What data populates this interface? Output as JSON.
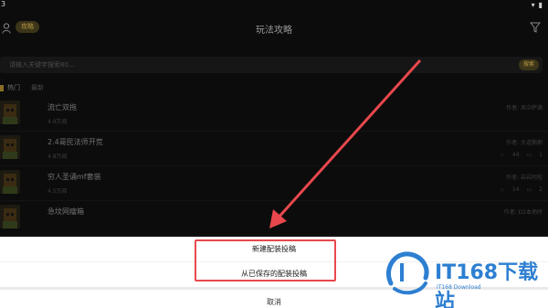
{
  "status_bar": {
    "time": "3"
  },
  "header": {
    "badge": "攻略",
    "title": "玩法攻略"
  },
  "search": {
    "placeholder": "请输入关键字搜索80...",
    "button": "搜索"
  },
  "tabs": [
    {
      "label": "热门"
    },
    {
      "label": "最新"
    }
  ],
  "list": [
    {
      "name": "流亡双拖",
      "count": "4.9万阅",
      "author": "作者: 风中萨满",
      "stats": ""
    },
    {
      "name": "2.4哥民法师开荒",
      "count": "4.8万阅",
      "author": "作者: 大道鹅鹅",
      "stats_likes": "44",
      "stats_comments": "1"
    },
    {
      "name": "穷人圣诵mf套装",
      "count": "4.5万阅",
      "author": "作者: 岩岩阿啦",
      "stats_likes": "14",
      "stats_comments": "2"
    },
    {
      "name": "急坟网瘤箱",
      "count": "",
      "author": "作者: D2本地时",
      "stats": ""
    }
  ],
  "sheet": {
    "option1": "新建配装投稿",
    "option2": "从已保存的配装投稿",
    "cancel": "取消"
  },
  "watermark": {
    "main": "IT168下载站",
    "sub": "IT168 Download"
  },
  "colors": {
    "highlight": "#e8484d",
    "arrow": "#e8484d",
    "watermark": "#2d7fd1",
    "accent": "#b89a43"
  }
}
